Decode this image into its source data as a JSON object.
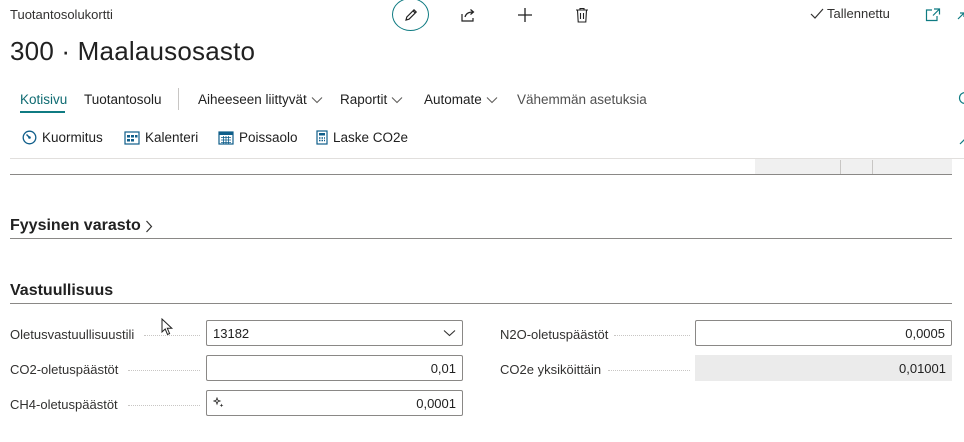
{
  "header": {
    "breadcrumb": "Tuotantosolukortti",
    "title": "300 · Maalausosasto",
    "saved_label": "Tallennettu"
  },
  "nav": {
    "items": [
      {
        "label": "Kotisivu"
      },
      {
        "label": "Tuotantosolu"
      },
      {
        "label": "Aiheeseen liittyvät"
      },
      {
        "label": "Raportit"
      },
      {
        "label": "Automate"
      },
      {
        "label": "Vähemmän asetuksia"
      }
    ]
  },
  "actions": {
    "items": [
      {
        "label": "Kuormitus"
      },
      {
        "label": "Kalenteri"
      },
      {
        "label": "Poissaolo"
      },
      {
        "label": "Laske CO2e"
      }
    ]
  },
  "sections": {
    "inventory": {
      "title": "Fyysinen varasto"
    },
    "sustainability": {
      "title": "Vastuullisuus"
    }
  },
  "fields": {
    "default_sust_account": {
      "label": "Oletusvastuullisuustili",
      "value": "13182"
    },
    "co2_default": {
      "label": "CO2-oletuspäästöt",
      "value": "0,01"
    },
    "ch4_default": {
      "label": "CH4-oletuspäästöt",
      "value": "0,0001"
    },
    "n2o_default": {
      "label": "N2O-oletuspäästöt",
      "value": "0,0005"
    },
    "co2e_per_unit": {
      "label": "CO2e yksiköittäin",
      "value": "0,01001"
    }
  },
  "colors": {
    "accent": "#0f7b82"
  }
}
